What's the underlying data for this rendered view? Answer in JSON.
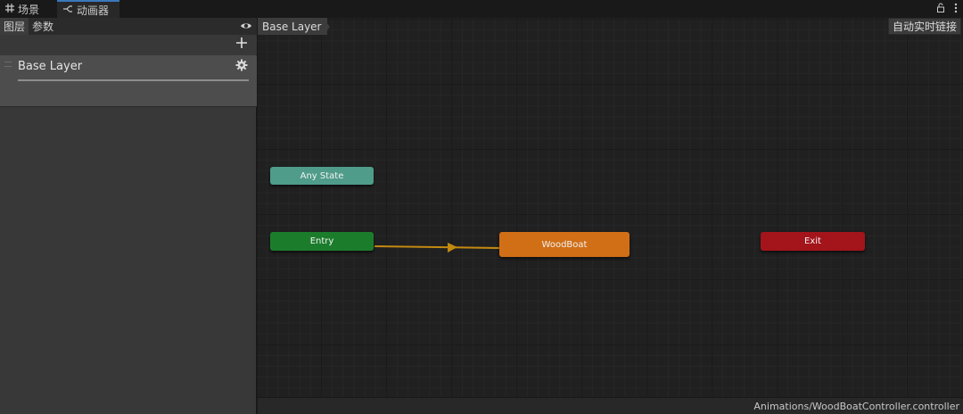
{
  "tabs": {
    "scene": {
      "label": "场景",
      "icon": "grid-icon"
    },
    "animator": {
      "label": "动画器",
      "icon": "animator-icon"
    }
  },
  "left_panel": {
    "tabs": [
      {
        "label": "图层"
      },
      {
        "label": "参数"
      }
    ],
    "layer": {
      "name": "Base Layer"
    }
  },
  "graph": {
    "breadcrumb": "Base Layer",
    "auto_live_link": "自动实时链接",
    "nodes": {
      "any_state": {
        "label": "Any State",
        "color": "#4f9c8a"
      },
      "entry": {
        "label": "Entry",
        "color": "#1b7d2c"
      },
      "woodboat": {
        "label": "WoodBoat",
        "color": "#d06f16"
      },
      "exit": {
        "label": "Exit",
        "color": "#a4141b"
      }
    },
    "transition_color": "#c38a10"
  },
  "status": {
    "path": "Animations/WoodBoatController.controller"
  }
}
